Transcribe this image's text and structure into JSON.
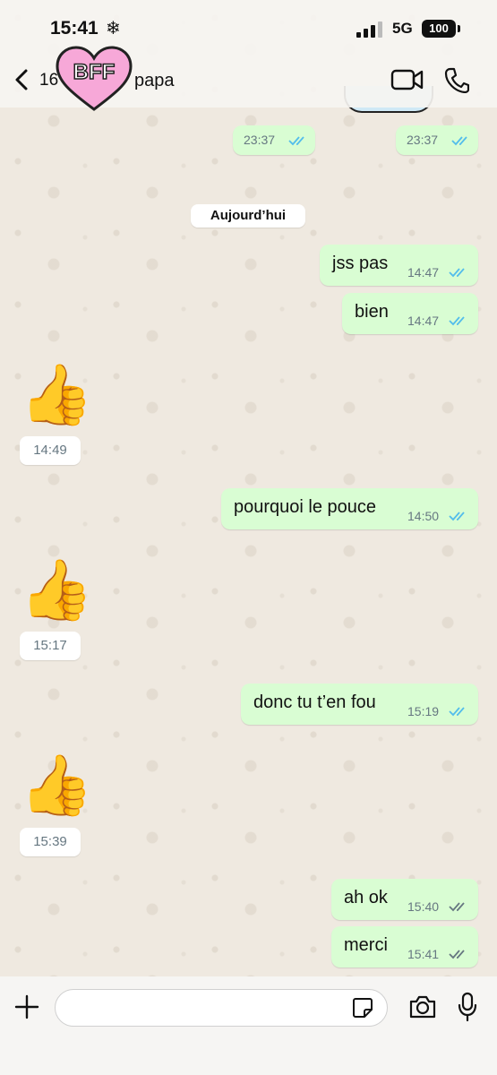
{
  "status_bar": {
    "time": "15:41",
    "weather_glyph": "❄",
    "network": "5G",
    "battery": "100"
  },
  "header": {
    "back_count": "16",
    "avatar_text": "BFF",
    "contact_name": "papa",
    "icons": [
      "chevron-left-icon",
      "video-call-icon",
      "phone-call-icon"
    ]
  },
  "day_separator": "Aujourd’hui",
  "earlier_times": [
    "23:37",
    "23:37"
  ],
  "messages": [
    {
      "dir": "out",
      "text": "jss pas",
      "time": "14:47",
      "read": true
    },
    {
      "dir": "out",
      "text": "bien",
      "time": "14:47",
      "read": true
    },
    {
      "dir": "in",
      "text": "👍",
      "time": "14:49"
    },
    {
      "dir": "out",
      "text": "pourquoi le pouce",
      "time": "14:50",
      "read": true
    },
    {
      "dir": "in",
      "text": "👍",
      "time": "15:17"
    },
    {
      "dir": "out",
      "text": "donc tu t’en fou",
      "time": "15:19",
      "read": true
    },
    {
      "dir": "in",
      "text": "👍",
      "time": "15:39"
    },
    {
      "dir": "out",
      "text": "ah ok",
      "time": "15:40",
      "read": false
    },
    {
      "dir": "out",
      "text": "merci",
      "time": "15:41",
      "read": false
    }
  ],
  "composer": {
    "value": "",
    "icons": [
      "plus-icon",
      "sticker-icon",
      "camera-icon",
      "microphone-icon"
    ]
  },
  "colors": {
    "outgoing_bubble": "#d9fdd3",
    "incoming_bubble": "#ffffff",
    "read_ticks": "#53bdeb",
    "delivered_ticks": "#667781",
    "avatar_heart": "#f7a8d8"
  }
}
